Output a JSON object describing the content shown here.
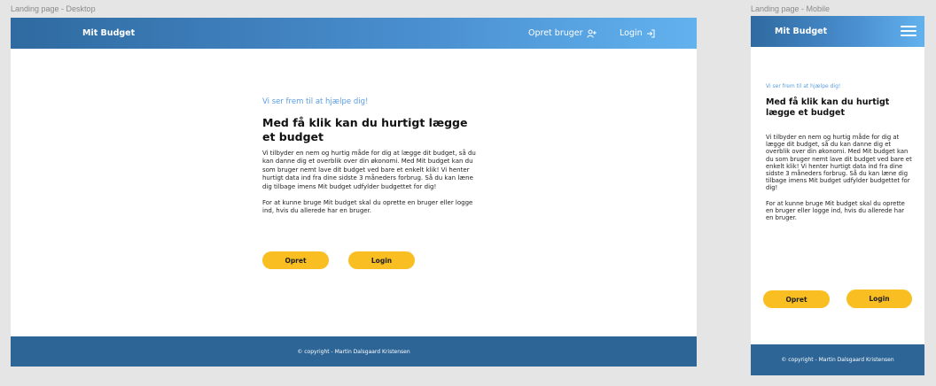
{
  "frames": {
    "desktop_label": "Landing page - Desktop",
    "mobile_label": "Landing page - Mobile"
  },
  "colors": {
    "nav_gradient_start": "#2f6aa0",
    "nav_gradient_end": "#62b2ee",
    "accent_yellow": "#f9be22",
    "footer_blue": "#2d6596",
    "tagline_blue": "#5b9de0"
  },
  "desktop": {
    "nav": {
      "brand": "Mit Budget",
      "create_user": "Opret bruger",
      "create_user_icon": "user-plus-icon",
      "login": "Login",
      "login_icon": "login-arrow-icon"
    },
    "main": {
      "tagline": "Vi ser frem til at hjælpe dig!",
      "headline": "Med få klik kan du hurtigt lægge et budget",
      "paragraph1": "Vi tilbyder en nem og hurtig måde for dig at lægge dit budget, så du kan danne dig et overblik over din økonomi. Med Mit budget kan du som bruger nemt lave dit budget ved bare et enkelt klik! Vi henter hurtigt data ind fra dine sidste 3 måneders forbrug. Så du kan læne dig tilbage imens Mit budget udfylder budgettet for dig!",
      "paragraph2": "For at kunne bruge Mit budget skal du oprette en bruger eller logge ind, hvis du allerede har en bruger.",
      "create_button": "Opret",
      "login_button": "Login"
    },
    "footer": "© copyright - Martin Dalsgaard Kristensen"
  },
  "mobile": {
    "nav": {
      "brand": "Mit Budget",
      "menu_icon": "hamburger-menu-icon"
    },
    "main": {
      "tagline": "Vi ser frem til at hjælpe dig!",
      "headline": "Med få klik kan du hurtigt lægge et budget",
      "paragraph1": "Vi tilbyder en nem og hurtig måde for dig at lægge dit budget, så du kan danne dig et overblik over din økonomi. Med Mit budget kan du som bruger nemt lave dit budget ved bare et enkelt klik! Vi henter hurtigt data ind fra dine sidste 3 måneders forbrug. Så du kan læne dig tilbage imens Mit budget udfylder budgettet for dig!",
      "paragraph2": "For at kunne bruge Mit budget skal du oprette en bruger eller logge ind, hvis du allerede har en bruger.",
      "create_button": "Opret",
      "login_button": "Login"
    },
    "footer": "© copyright - Martin Dalsgaard Kristensen"
  }
}
